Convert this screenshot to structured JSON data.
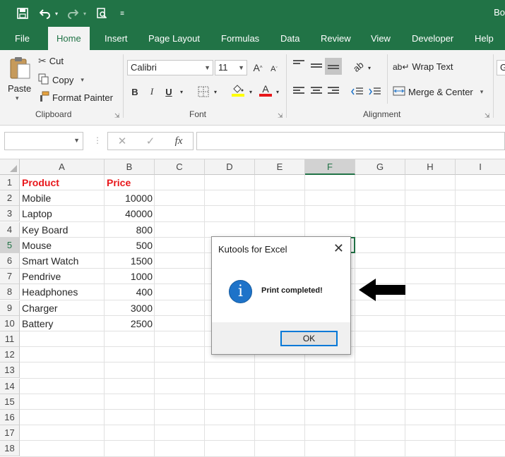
{
  "titlebar": {
    "title": "Bo"
  },
  "tabs": [
    "File",
    "Home",
    "Insert",
    "Page Layout",
    "Formulas",
    "Data",
    "Review",
    "View",
    "Developer",
    "Help"
  ],
  "ribbon": {
    "clipboard": {
      "paste": "Paste",
      "cut": "Cut",
      "copy": "Copy",
      "format_painter": "Format Painter",
      "label": "Clipboard"
    },
    "font": {
      "name": "Calibri",
      "size": "11",
      "label": "Font",
      "grow": "A",
      "shrink": "A",
      "bold": "B",
      "italic": "I",
      "underline": "U",
      "font_color": "A"
    },
    "alignment": {
      "wrap_text": "Wrap Text",
      "merge_center": "Merge & Center",
      "label": "Alignment"
    },
    "next_group_peek": "G"
  },
  "formula_bar": {
    "cancel": "✕",
    "enter": "✓",
    "fx": "fx"
  },
  "columns": [
    "A",
    "B",
    "C",
    "D",
    "E",
    "F",
    "G",
    "H",
    "I"
  ],
  "rows": [
    "1",
    "2",
    "3",
    "4",
    "5",
    "6",
    "7",
    "8",
    "9",
    "10",
    "11",
    "12",
    "13",
    "14",
    "15",
    "16",
    "17",
    "18"
  ],
  "table": {
    "headers": [
      "Product",
      "Price"
    ],
    "data": [
      [
        "Mobile",
        "10000"
      ],
      [
        "Laptop",
        "40000"
      ],
      [
        "Key Board",
        "800"
      ],
      [
        "Mouse",
        "500"
      ],
      [
        "Smart Watch",
        "1500"
      ],
      [
        "Pendrive",
        "1000"
      ],
      [
        "Headphones",
        "400"
      ],
      [
        "Charger",
        "3000"
      ],
      [
        "Battery",
        "2500"
      ]
    ]
  },
  "dialog": {
    "title": "Kutools for Excel",
    "message": "Print completed!",
    "ok": "OK",
    "icon_letter": "i"
  },
  "colors": {
    "excel_green": "#217346",
    "header_red": "#e8171b",
    "info_blue": "#1e73c9"
  }
}
